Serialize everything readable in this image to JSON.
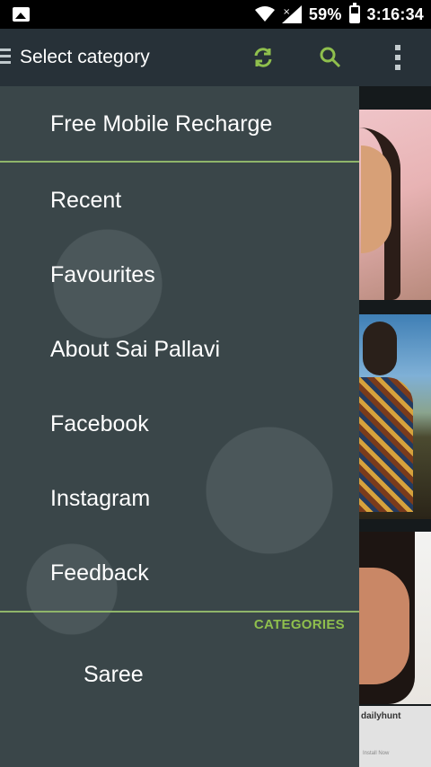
{
  "status_bar": {
    "battery": "59%",
    "time": "3:16:34",
    "icons": [
      "gallery-icon",
      "wifi-icon",
      "signal-icon",
      "battery-icon"
    ]
  },
  "app_bar": {
    "title": "Select category",
    "icons": [
      "menu-icon",
      "refresh-icon",
      "search-icon",
      "overflow-menu-icon"
    ],
    "accent_color": "#8fbf4d"
  },
  "drawer": {
    "top_item": "Free Mobile Recharge",
    "items": [
      "Recent",
      "Favourites",
      "About Sai Pallavi",
      "Facebook",
      "Instagram",
      "Feedback"
    ],
    "section_header": "CATEGORIES",
    "categories": [
      "Saree"
    ]
  },
  "background": {
    "ad_brand": "dailyhunt",
    "ad_sub": "Install Now"
  }
}
